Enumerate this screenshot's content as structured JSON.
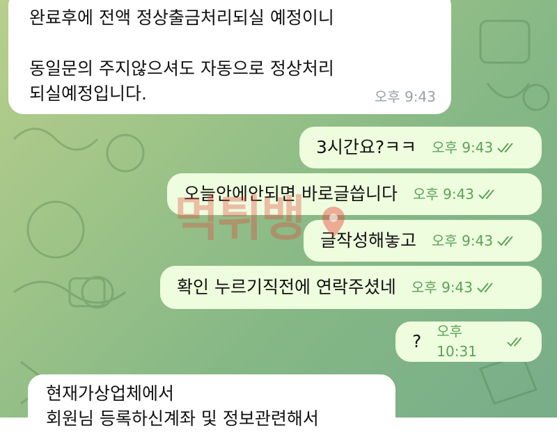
{
  "theme": {
    "incoming_bg": "#ffffff",
    "outgoing_bg": "#eefdde",
    "time_in_color": "#9aa0a6",
    "time_out_color": "#5aa257",
    "checks_color": "#5aa257"
  },
  "watermark": {
    "text": "먹튀뱅"
  },
  "messages": [
    {
      "dir": "incoming",
      "text": "완료후에 전액 정상출금처리되실 예정이니\n\n동일문의 주지않으셔도 자동으로 정상처리\n되실예정입니다.",
      "time": "오후 9:43"
    },
    {
      "dir": "outgoing",
      "text": "3시간요?ㅋㅋ",
      "time": "오후 9:43",
      "status": "read-double-check-icon"
    },
    {
      "dir": "outgoing",
      "text": "오늘안에안되면 바로글씁니다",
      "time": "오후 9:43",
      "status": "read-double-check-icon"
    },
    {
      "dir": "outgoing",
      "text": "글작성해놓고",
      "time": "오후 9:43",
      "status": "read-double-check-icon"
    },
    {
      "dir": "outgoing",
      "text": "확인 누르기직전에 연락주셨네",
      "time": "오후 9:43",
      "status": "read-double-check-icon"
    },
    {
      "dir": "outgoing",
      "text": "?",
      "time": "오후 10:31",
      "status": "read-double-check-icon"
    },
    {
      "dir": "incoming",
      "text": "현재가상업체에서\n회원님 등록하신계좌 및 정보관련해서",
      "time": ""
    }
  ]
}
